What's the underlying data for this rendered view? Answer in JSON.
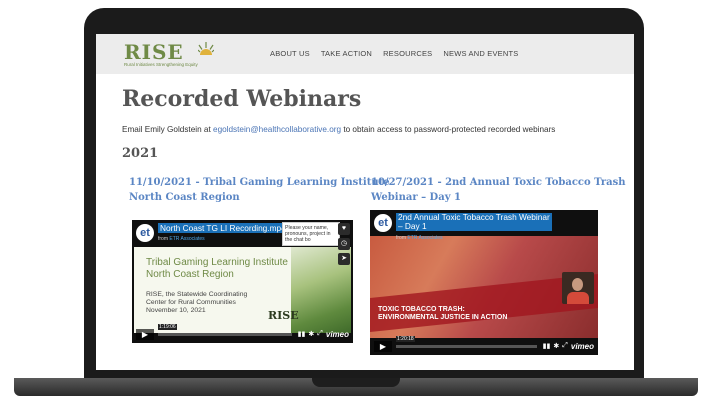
{
  "site": {
    "logo_text": "RISE",
    "logo_tagline": "Rural Initiatives Strengthening Equity",
    "nav": [
      "ABOUT US",
      "TAKE ACTION",
      "RESOURCES",
      "NEWS AND EVENTS"
    ]
  },
  "page": {
    "title": "Recorded Webinars",
    "email_prefix": "Email Emily Goldstein at ",
    "email_link": "egoldstein@healthcollaborative.org",
    "email_suffix": " to obtain access to password-protected recorded webinars",
    "year": "2021"
  },
  "webinars": [
    {
      "heading_line1": "11/10/2021 - Tribal Gaming Learning Institute",
      "heading_line2": "North Coast Region",
      "video_title": "North Coast TG LI Recording.mp4",
      "from_label": "from",
      "from_name": "ETR Associates",
      "badge": "et",
      "tooltip": "Please your name, pronouns, project in the chat bo",
      "slide_title_line1": "Tribal Gaming Learning Institute",
      "slide_title_line2": "North Coast Region",
      "slide_sub_line1": "RISE, the Statewide Coordinating",
      "slide_sub_line2": "Center for Rural Communities",
      "slide_sub_line3": "November 10, 2021",
      "slide_logo": "RISE",
      "time": "1:19:06",
      "vimeo": "vimeo"
    },
    {
      "heading_line1": "10/27/2021 - 2nd Annual Toxic Tobacco Trash",
      "heading_line2": "Webinar – Day 1",
      "video_title_line1": "2nd Annual Toxic Tobacco Trash Webinar",
      "video_title_line2": "– Day 1",
      "from_label": "from",
      "from_name": "ETR Associates",
      "badge": "et",
      "slide_text_line1": "TOXIC TOBACCO TRASH:",
      "slide_text_line2": "ENVIRONMENTAL JUSTICE IN ACTION",
      "time": "1:20:18",
      "vimeo": "vimeo"
    }
  ]
}
